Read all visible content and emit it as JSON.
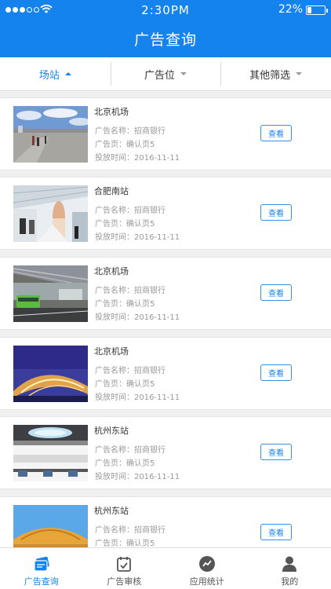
{
  "status_bar": {
    "time": "2:30PM",
    "battery": "22%",
    "battery_level": 0.22
  },
  "header": {
    "title": "广告查询"
  },
  "filters": [
    {
      "label": "场站",
      "active": true
    },
    {
      "label": "广告位",
      "active": false
    },
    {
      "label": "其他筛选",
      "active": false
    }
  ],
  "ads": [
    {
      "station": "北京机场",
      "ad_name": "广告名称：招商银行",
      "ad_page": "广告页：确认页5",
      "time": "投放时间：2016-11-11",
      "button": "查看"
    },
    {
      "station": "合肥南站",
      "ad_name": "广告名称：招商银行",
      "ad_page": "广告页：确认页5",
      "time": "投放时间：2016-11-11",
      "button": "查看"
    },
    {
      "station": "北京机场",
      "ad_name": "广告名称：招商银行",
      "ad_page": "广告页：确认页5",
      "time": "投放时间：2016-11-11",
      "button": "查看"
    },
    {
      "station": "北京机场",
      "ad_name": "广告名称：招商银行",
      "ad_page": "广告页：确认页5",
      "time": "投放时间：2016-11-11",
      "button": "查看"
    },
    {
      "station": "杭州东站",
      "ad_name": "广告名称：招商银行",
      "ad_page": "广告页：确认页5",
      "time": "投放时间：2016-11-11",
      "button": "查看"
    },
    {
      "station": "杭州东站",
      "ad_name": "广告名称：招商银行",
      "ad_page": "广告页：确认页5",
      "time": "",
      "button": "查看"
    }
  ],
  "tabbar": [
    {
      "label": "广告查询",
      "icon": "ad-search-icon",
      "active": true
    },
    {
      "label": "广告审核",
      "icon": "calendar-check-icon",
      "active": false
    },
    {
      "label": "应用统计",
      "icon": "stats-icon",
      "active": false
    },
    {
      "label": "我的",
      "icon": "person-icon",
      "active": false
    }
  ],
  "colors": {
    "accent": "#1583ee",
    "background": "#f0f0f0",
    "secondary_text": "#999999"
  }
}
